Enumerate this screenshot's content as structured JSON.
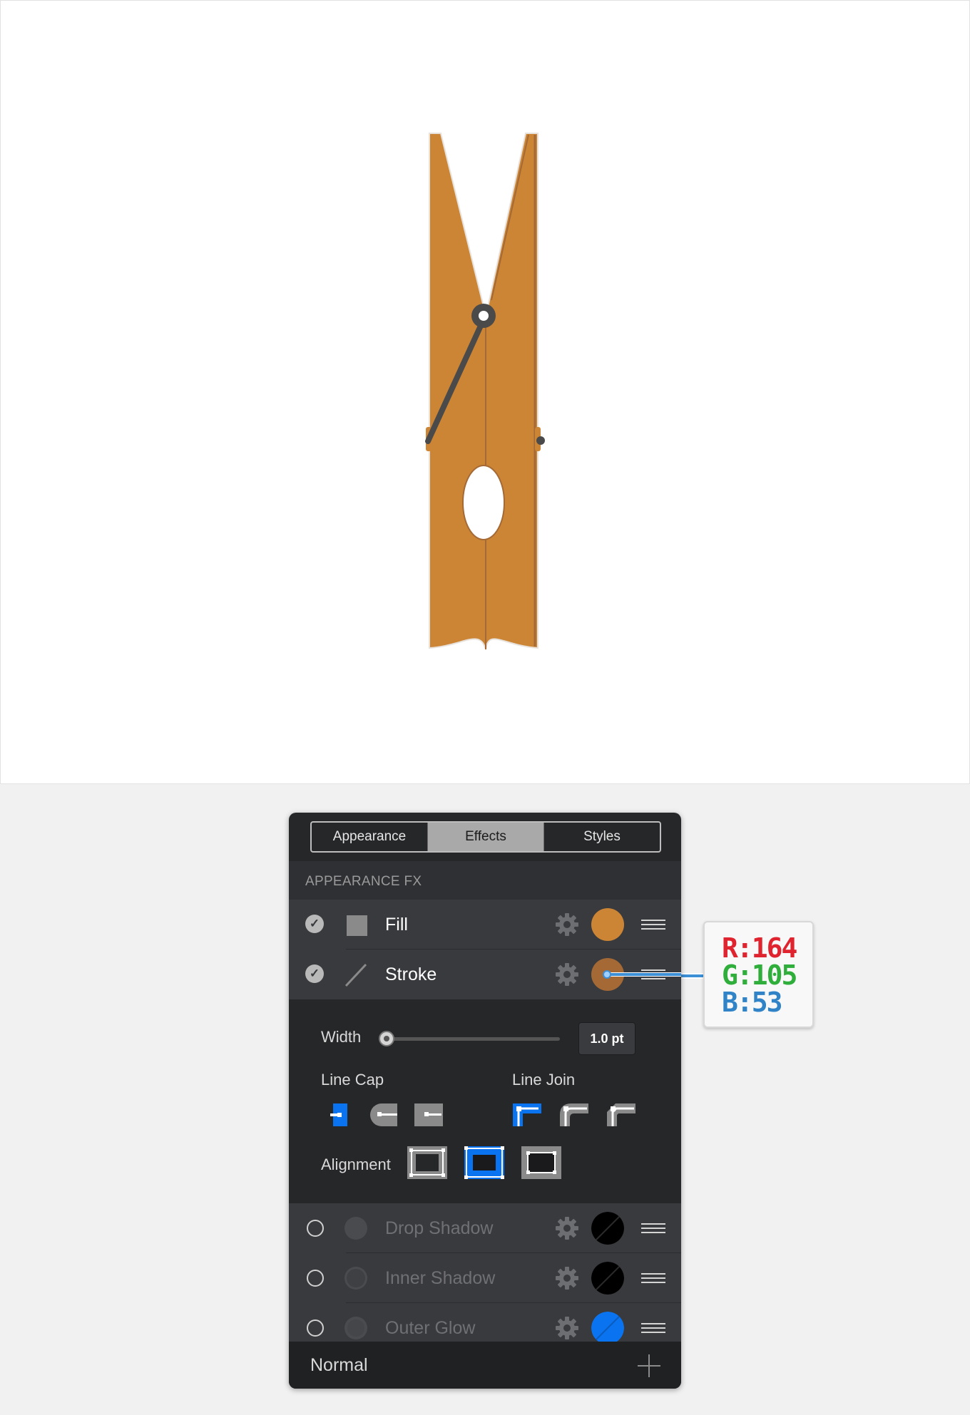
{
  "tabs": [
    "Appearance",
    "Effects",
    "Styles"
  ],
  "active_tab": "Effects",
  "section_title": "APPEARANCE FX",
  "fx_rows": [
    {
      "label": "Fill",
      "enabled": true,
      "icon": "fill-square-icon",
      "swatch_color": "#CC8535"
    },
    {
      "label": "Stroke",
      "enabled": true,
      "icon": "stroke-line-icon",
      "swatch_color": "#A46935"
    },
    {
      "label": "Drop Shadow",
      "enabled": false,
      "icon": "shadow-circle-icon",
      "swatch_color": "#000000"
    },
    {
      "label": "Inner Shadow",
      "enabled": false,
      "icon": "shadow-circle-icon",
      "swatch_color": "#000000"
    },
    {
      "label": "Outer Glow",
      "enabled": false,
      "icon": "glow-circle-icon",
      "swatch_color": "#0A74F0"
    }
  ],
  "stroke": {
    "width_label": "Width",
    "width_value": "1.0 pt",
    "slider_level": 0.0,
    "line_cap_label": "Line Cap",
    "line_join_label": "Line Join",
    "alignment_label": "Alignment",
    "selected_cap": "butt",
    "selected_join": "miter",
    "selected_alignment": "center"
  },
  "blend_mode": "Normal",
  "color_callout": {
    "r": "R:164",
    "g": "G:105",
    "b": "B:53"
  },
  "colors": {
    "accent_blue": "#0A74F0",
    "clothespin_fill": "#CC8535",
    "clothespin_stroke": "#A46935",
    "spring": "#4A4A4A"
  }
}
